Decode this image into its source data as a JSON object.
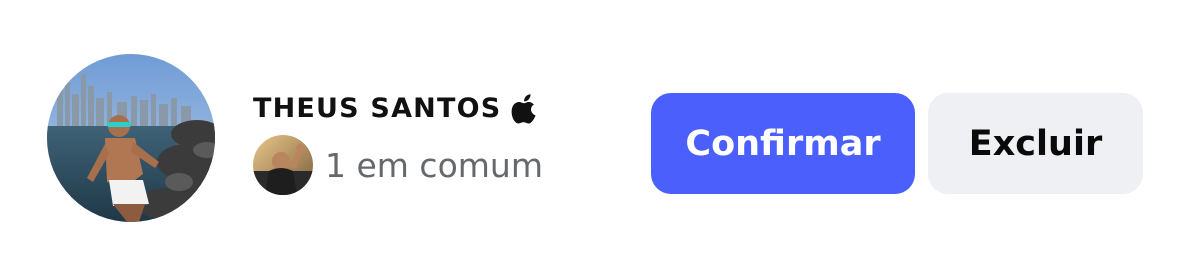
{
  "request": {
    "user_name": "THEUS SANTOS",
    "badge_icon": "apple-icon",
    "avatar_icon": "profile-photo",
    "mutual_avatar_icon": "mutual-friend-photo",
    "mutual_text": "1 em comum"
  },
  "actions": {
    "confirm_label": "Confirmar",
    "delete_label": "Excluir"
  },
  "colors": {
    "confirm_bg": "#4a5ffb",
    "delete_bg": "#eef0f3",
    "name": "#111111",
    "muted": "#65686c"
  }
}
